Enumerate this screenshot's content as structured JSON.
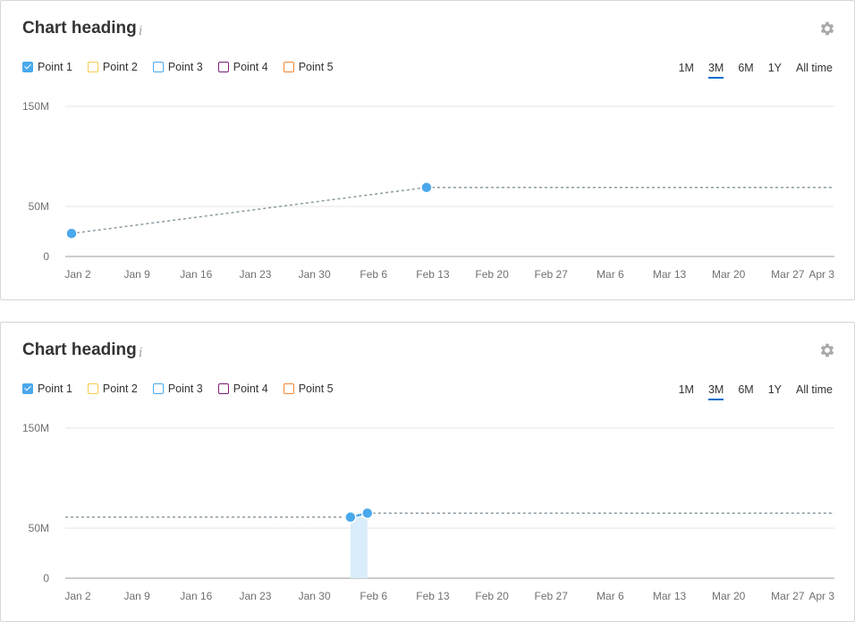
{
  "legend_labels": [
    "Point 1",
    "Point 2",
    "Point 3",
    "Point 4",
    "Point 5"
  ],
  "legend_colors": [
    "#4aa8ec",
    "#f7c94b",
    "#4aa8ec",
    "#7b1e7a",
    "#f58634"
  ],
  "legend_checked": [
    true,
    false,
    false,
    false,
    false
  ],
  "range_options": [
    "1M",
    "3M",
    "6M",
    "1Y",
    "All time"
  ],
  "colors": {
    "point": "#4aa8ec",
    "line": "#8a9aa0",
    "highlight": "#d9edfb",
    "grid": "#e4e4e4",
    "axis": "#999999"
  },
  "cards": [
    {
      "heading": "Chart heading",
      "info_icon": "info-icon",
      "settings_icon": "gear-icon",
      "selected_range": "3M"
    },
    {
      "heading": "Chart heading",
      "info_icon": "info-icon",
      "settings_icon": "gear-icon",
      "selected_range": "3M"
    }
  ],
  "chart_data": [
    {
      "type": "line",
      "x_ticks": [
        "Jan 2",
        "Jan 9",
        "Jan 16",
        "Jan 23",
        "Jan 30",
        "Feb 6",
        "Feb 13",
        "Feb 20",
        "Feb 27",
        "Mar 6",
        "Mar 13",
        "Mar 20",
        "Mar 27",
        "Apr 3"
      ],
      "y_ticks": [
        "0",
        "50M",
        "150M"
      ],
      "ylim": [
        0,
        150000000
      ],
      "xlim": [
        "2023-01-02",
        "2023-04-03"
      ],
      "grid": true,
      "series": [
        {
          "x": [
            "2023-01-02",
            "2023-02-13"
          ],
          "y": [
            23000000,
            69000000
          ],
          "extend_to": "2023-04-03"
        }
      ]
    },
    {
      "type": "line",
      "x_ticks": [
        "Jan 2",
        "Jan 9",
        "Jan 16",
        "Jan 23",
        "Jan 30",
        "Feb 6",
        "Feb 13",
        "Feb 20",
        "Feb 27",
        "Mar 6",
        "Mar 13",
        "Mar 20",
        "Mar 27",
        "Apr 3"
      ],
      "y_ticks": [
        "0",
        "50M",
        "150M"
      ],
      "ylim": [
        0,
        150000000
      ],
      "xlim": [
        "2023-01-02",
        "2023-04-03"
      ],
      "grid": true,
      "series": [
        {
          "x": [
            "2023-02-04",
            "2023-02-06"
          ],
          "y": [
            61000000,
            65000000
          ],
          "extend_from": "2023-01-02",
          "extend_to": "2023-04-03",
          "highlight": [
            "2023-02-04",
            "2023-02-06"
          ]
        }
      ]
    }
  ]
}
